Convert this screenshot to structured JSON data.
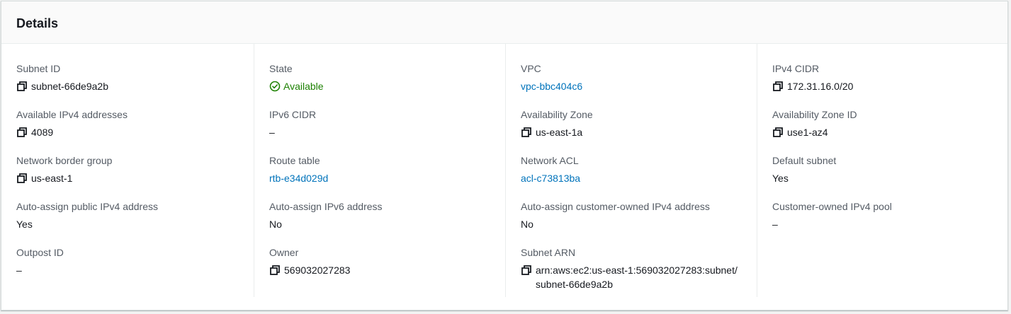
{
  "panel": {
    "title": "Details"
  },
  "colors": {
    "link": "#0073bb",
    "success": "#1d8102",
    "label": "#545b64"
  },
  "columns": [
    [
      {
        "label": "Subnet ID",
        "value": "subnet-66de9a2b",
        "type": "copy",
        "icon": "copy-icon"
      },
      {
        "label": "Available IPv4 addresses",
        "value": "4089",
        "type": "copy",
        "icon": "copy-icon"
      },
      {
        "label": "Network border group",
        "value": "us-east-1",
        "type": "copy",
        "icon": "copy-icon"
      },
      {
        "label": "Auto-assign public IPv4 address",
        "value": "Yes",
        "type": "text"
      },
      {
        "label": "Outpost ID",
        "value": "–",
        "type": "text"
      }
    ],
    [
      {
        "label": "State",
        "value": "Available",
        "type": "status",
        "icon": "check-circle-icon"
      },
      {
        "label": "IPv6 CIDR",
        "value": "–",
        "type": "text"
      },
      {
        "label": "Route table",
        "value": "rtb-e34d029d",
        "type": "link"
      },
      {
        "label": "Auto-assign IPv6 address",
        "value": "No",
        "type": "text"
      },
      {
        "label": "Owner",
        "value": "569032027283",
        "type": "copy",
        "icon": "copy-icon"
      }
    ],
    [
      {
        "label": "VPC",
        "value": "vpc-bbc404c6",
        "type": "link"
      },
      {
        "label": "Availability Zone",
        "value": "us-east-1a",
        "type": "copy",
        "icon": "copy-icon"
      },
      {
        "label": "Network ACL",
        "value": "acl-c73813ba",
        "type": "link"
      },
      {
        "label": "Auto-assign customer-owned IPv4 address",
        "value": "No",
        "type": "text"
      },
      {
        "label": "Subnet ARN",
        "value": "arn:aws:ec2:us-east-1:569032027283:subnet/subnet-66de9a2b",
        "type": "copy",
        "icon": "copy-icon"
      }
    ],
    [
      {
        "label": "IPv4 CIDR",
        "value": "172.31.16.0/20",
        "type": "copy",
        "icon": "copy-icon"
      },
      {
        "label": "Availability Zone ID",
        "value": "use1-az4",
        "type": "copy",
        "icon": "copy-icon"
      },
      {
        "label": "Default subnet",
        "value": "Yes",
        "type": "text"
      },
      {
        "label": "Customer-owned IPv4 pool",
        "value": "–",
        "type": "text"
      }
    ]
  ]
}
